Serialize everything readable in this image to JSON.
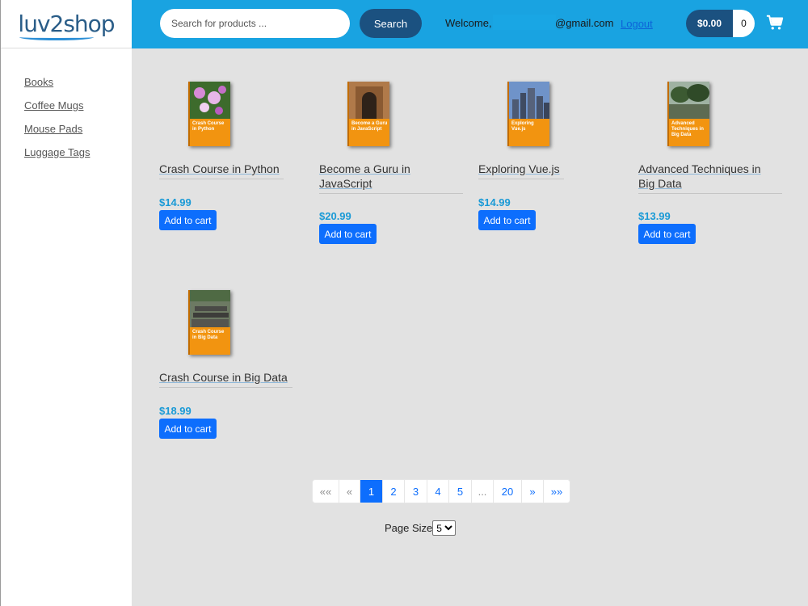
{
  "brand": {
    "logo_text": "luv2shop"
  },
  "sidebar": {
    "items": [
      {
        "label": "Books"
      },
      {
        "label": "Coffee Mugs"
      },
      {
        "label": "Mouse Pads"
      },
      {
        "label": "Luggage Tags"
      }
    ]
  },
  "header": {
    "search_placeholder": "Search for products ...",
    "search_button": "Search",
    "welcome": "Welcome,",
    "email_domain": "@gmail.com",
    "logout": "Logout",
    "cart_total": "$0.00",
    "cart_count": "0",
    "cart_icon": "cart-icon"
  },
  "products": [
    {
      "name": "Crash Course in Python",
      "price": "$14.99",
      "button": "Add to cart",
      "cover_text": "Crash Course in Python",
      "cover_color": "#f29410"
    },
    {
      "name": "Become a Guru in JavaScript",
      "price": "$20.99",
      "button": "Add to cart",
      "cover_text": "Become a Guru in JavaScript",
      "cover_color": "#f29410"
    },
    {
      "name": "Exploring Vue.js",
      "price": "$14.99",
      "button": "Add to cart",
      "cover_text": "Exploring Vue.js",
      "cover_color": "#f29410"
    },
    {
      "name": "Advanced Techniques in Big Data",
      "price": "$13.99",
      "button": "Add to cart",
      "cover_text": "Advanced Techniques in Big Data",
      "cover_color": "#f29410"
    },
    {
      "name": "Crash Course in Big Data",
      "price": "$18.99",
      "button": "Add to cart",
      "cover_text": "Crash Course in Big Data",
      "cover_color": "#f29410"
    }
  ],
  "pagination": {
    "first": "««",
    "prev": "«",
    "pages": [
      "1",
      "2",
      "3",
      "4",
      "5",
      "...",
      "20"
    ],
    "current": "1",
    "next": "»",
    "last": "»»"
  },
  "page_size": {
    "label": "Page Size",
    "value": "5"
  },
  "colors": {
    "header": "#19a3e1",
    "button_dark": "#1b5180",
    "primary": "#0d6efd",
    "price": "#1a9ad6",
    "background": "#e2e2e2"
  }
}
